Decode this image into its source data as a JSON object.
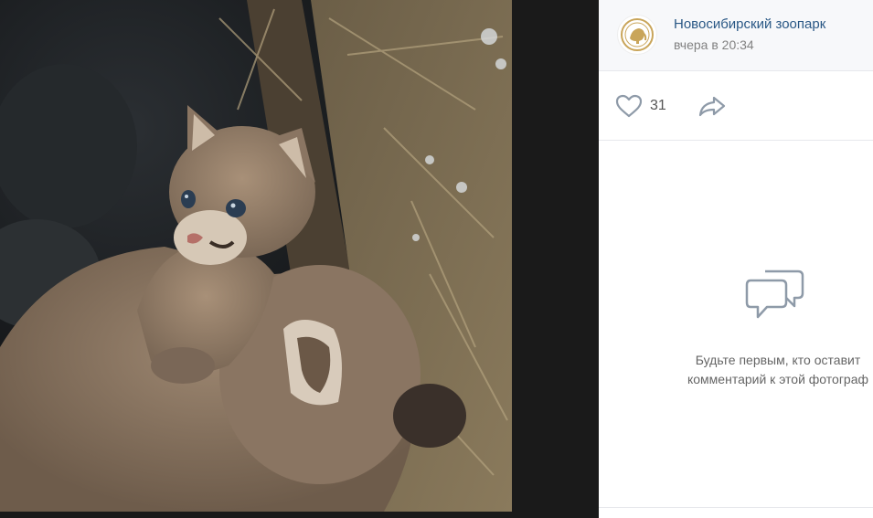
{
  "post": {
    "author": "Новосибирский зоопарк",
    "date": "вчера в 20:34",
    "likes": "31"
  },
  "comments": {
    "empty_line1": "Будьте первым, кто оставит",
    "empty_line2": "комментарий к этой фотограф"
  },
  "colors": {
    "link": "#2a5885",
    "muted": "#828282",
    "icon": "#8e9aa8"
  },
  "icons": [
    "heart-icon",
    "share-icon",
    "comments-icon"
  ]
}
